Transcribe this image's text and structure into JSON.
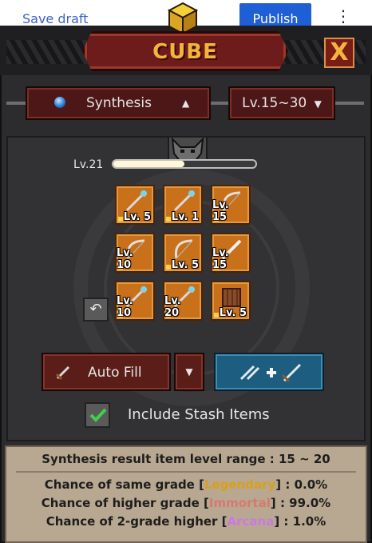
{
  "browser": {
    "save_draft": "Save draft",
    "publish": "Publish",
    "more": "⋮"
  },
  "header": {
    "title": "CUBE",
    "close": "X"
  },
  "filters": {
    "mode": "Synthesis",
    "level_range": "Lv.15~30"
  },
  "progress": {
    "label": "Lv.21",
    "fraction": 0.5
  },
  "slots": [
    {
      "icon": "staff-icon",
      "level": "Lv. 5"
    },
    {
      "icon": "staff-icon",
      "level": "Lv. 1"
    },
    {
      "icon": "bow-icon",
      "level": "Lv. 15"
    },
    {
      "icon": "bow-icon",
      "level": "Lv. 10"
    },
    {
      "icon": "bow-icon",
      "level": "Lv. 5"
    },
    {
      "icon": "sword-icon",
      "level": "Lv. 15"
    },
    {
      "icon": "staff-icon",
      "level": "Lv. 10"
    },
    {
      "icon": "staff-icon",
      "level": "Lv. 20"
    },
    {
      "icon": "shield-icon",
      "level": "Lv. 5"
    }
  ],
  "actions": {
    "auto_fill": "Auto Fill",
    "include_stash": "Include Stash Items",
    "include_checked": true
  },
  "info": {
    "range_line": "Synthesis result item level range : 15 ~ 20",
    "same_prefix": "Chance of same grade [",
    "same_grade": "Legendary",
    "same_suffix": "] : 0.0%",
    "higher_prefix": "Chance of higher grade [",
    "higher_grade": "Immortal",
    "higher_suffix": "] : 99.0%",
    "two_prefix": "Chance of 2-grade higher [",
    "two_grade": "Arcana",
    "two_suffix": "] : 1.0%"
  },
  "colors": {
    "legendary": "#d8a01a",
    "immortal": "#d8796d",
    "arcana": "#cc78e0",
    "title": "#f2b43d"
  }
}
